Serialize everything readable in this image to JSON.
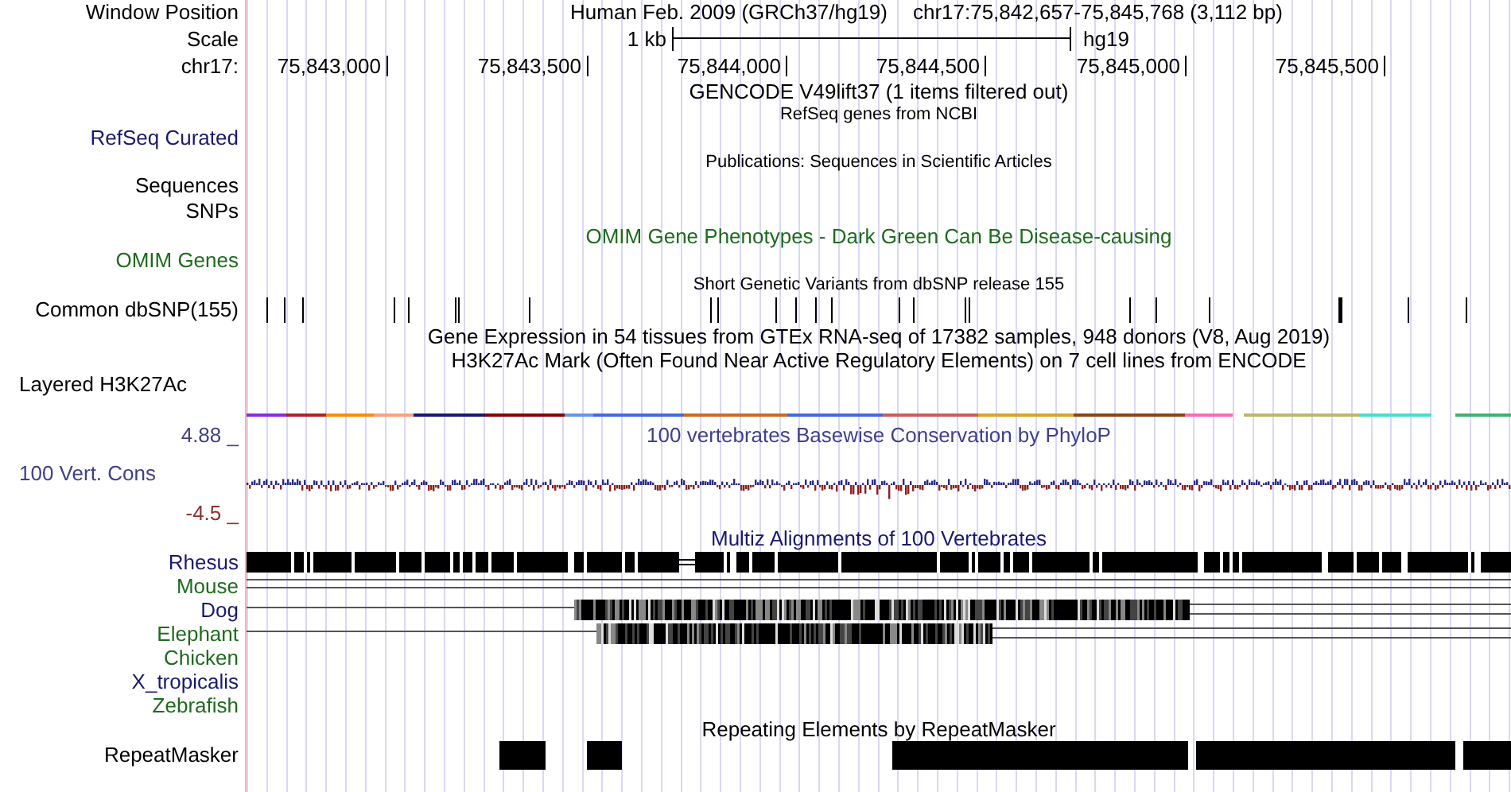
{
  "header": {
    "label": "Window Position",
    "title": "Human Feb. 2009 (GRCh37/hg19)",
    "position": "chr17:75,842,657-75,845,768 (3,112 bp)"
  },
  "scale": {
    "label": "Scale",
    "bar_label": "1 kb",
    "assembly": "hg19"
  },
  "ruler": {
    "label": "chr17:",
    "ticks": [
      "75,843,000",
      "75,843,500",
      "75,844,000",
      "75,844,500",
      "75,845,000",
      "75,845,500"
    ]
  },
  "tracks": [
    {
      "kind": "title",
      "title": "GENCODE V49lift37 (1 items filtered out)",
      "color": "#000000"
    },
    {
      "kind": "caption",
      "title": "RefSeq genes from NCBI",
      "color": "#000000"
    },
    {
      "kind": "blank",
      "label": "RefSeq Curated",
      "color": "#191970"
    },
    {
      "kind": "caption",
      "title": "Publications: Sequences in Scientific Articles",
      "color": "#000000"
    },
    {
      "kind": "blank",
      "label": "Sequences",
      "color": "#000000"
    },
    {
      "kind": "blank",
      "label": "SNPs",
      "color": "#000000"
    },
    {
      "kind": "title",
      "title": "OMIM Gene Phenotypes - Dark Green Can Be Disease-causing",
      "color": "#1e6b1e"
    },
    {
      "kind": "blank",
      "label": "OMIM Genes",
      "color": "#1e6b1e"
    },
    {
      "kind": "caption",
      "title": "Short Genetic Variants from dbSNP release 155",
      "color": "#000000"
    },
    {
      "kind": "snp_ticks",
      "label": "Common dbSNP(155)",
      "color": "#000000"
    },
    {
      "kind": "title",
      "title": "Gene Expression in 54 tissues from GTEx RNA-seq of 17382 samples, 948 donors (V8, Aug 2019)",
      "color": "#000000"
    },
    {
      "kind": "title",
      "title": "H3K27Ac Mark (Often Found Near Active Regulatory Elements) on 7 cell lines from ENCODE",
      "color": "#000000"
    },
    {
      "kind": "layered",
      "label": "Layered H3K27Ac",
      "color": "#000000"
    },
    {
      "kind": "title",
      "label": "4.88 _",
      "title": "100 vertebrates Basewise Conservation by PhyloP",
      "color": "#40408c"
    },
    {
      "kind": "wiggle",
      "label": "100 Vert. Cons",
      "color": "#40408c"
    },
    {
      "kind": "blank",
      "label": "-4.5 _",
      "color": "#8c3030"
    },
    {
      "kind": "title",
      "title": "Multiz Alignments of 100 Vertebrates",
      "color": "#191970"
    },
    {
      "kind": "full_alignment",
      "label": "Rhesus",
      "color": "#191970"
    },
    {
      "kind": "line_alignment",
      "label": "Mouse",
      "color": "#1e6b1e"
    },
    {
      "kind": "partial_alignment",
      "label": "Dog",
      "color": "#191970"
    },
    {
      "kind": "partial_alignment",
      "label": "Elephant",
      "color": "#1e6b1e"
    },
    {
      "kind": "no_alignment",
      "label": "Chicken",
      "color": "#1e6b1e"
    },
    {
      "kind": "no_alignment",
      "label": "X_tropicalis",
      "color": "#191970"
    },
    {
      "kind": "no_alignment",
      "label": "Zebrafish",
      "color": "#1e6b1e"
    },
    {
      "kind": "title",
      "title": "Repeating Elements by RepeatMasker",
      "color": "#000000"
    },
    {
      "kind": "repeats",
      "label": "RepeatMasker",
      "color": "#000000"
    }
  ]
}
